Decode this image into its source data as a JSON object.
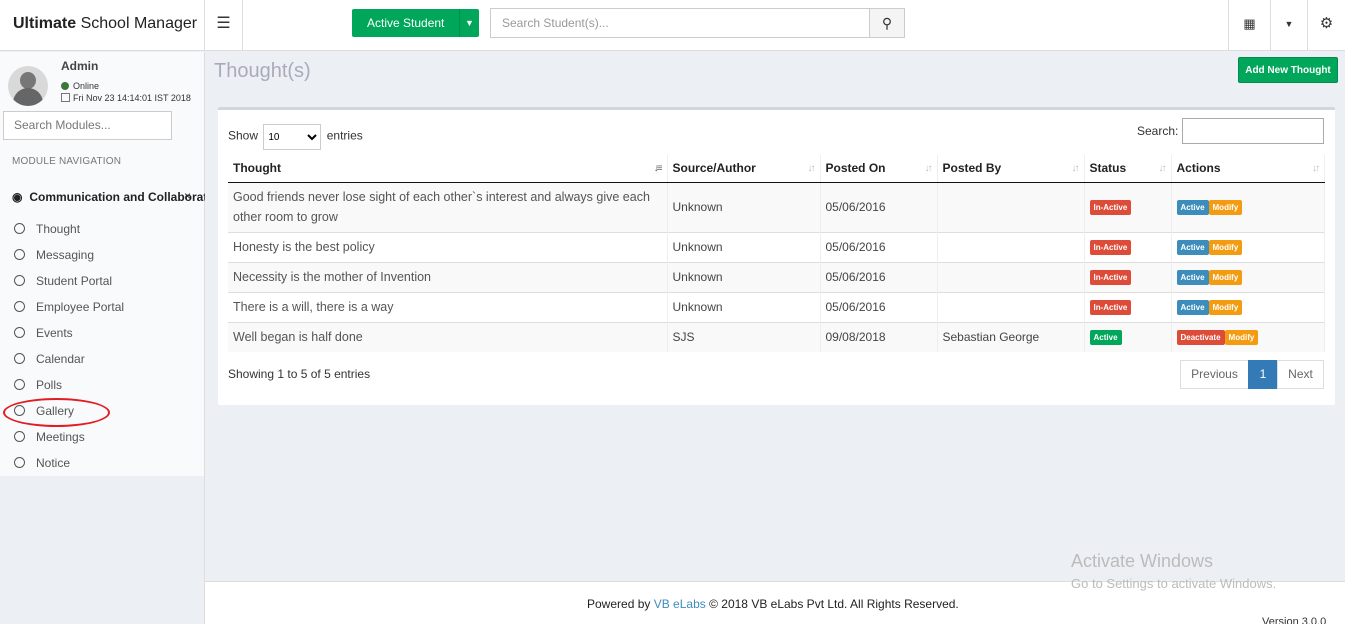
{
  "app": {
    "title_bold": "Ultimate",
    "title_rest": " School Manager"
  },
  "header": {
    "active_student": "Active Student",
    "search_placeholder": "Search Student(s)..."
  },
  "sidebar": {
    "user": "Admin",
    "status": "Online",
    "datetime": "Fri Nov 23 14:14:01 IST 2018",
    "search_placeholder": "Search Modules...",
    "section": "MODULE NAVIGATION",
    "group": "Communication and Collaborat",
    "items": [
      "Thought",
      "Messaging",
      "Student Portal",
      "Employee Portal",
      "Events",
      "Calendar",
      "Polls",
      "Gallery",
      "Meetings",
      "Notice"
    ]
  },
  "page": {
    "title": "Thought(s)",
    "add_button": "Add New Thought",
    "show_label": "Show",
    "entries_label": "entries",
    "entries_value": "10",
    "search_label": "Search:",
    "columns": [
      "Thought",
      "Source/Author",
      "Posted On",
      "Posted By",
      "Status",
      "Actions"
    ],
    "rows": [
      {
        "thought": "Good friends never lose sight of each other`s interest and always give each other room to grow",
        "author": "Unknown",
        "date": "05/06/2016",
        "by": "",
        "status": "In-Active",
        "a1": "Active",
        "a2": "Modify"
      },
      {
        "thought": "Honesty is the best policy",
        "author": "Unknown",
        "date": "05/06/2016",
        "by": "",
        "status": "In-Active",
        "a1": "Active",
        "a2": "Modify"
      },
      {
        "thought": "Necessity is the mother of Invention",
        "author": "Unknown",
        "date": "05/06/2016",
        "by": "",
        "status": "In-Active",
        "a1": "Active",
        "a2": "Modify"
      },
      {
        "thought": "There is a will, there is a way",
        "author": "Unknown",
        "date": "05/06/2016",
        "by": "",
        "status": "In-Active",
        "a1": "Active",
        "a2": "Modify"
      },
      {
        "thought": "Well began is half done",
        "author": "SJS",
        "date": "09/08/2018",
        "by": "Sebastian George",
        "status": "Active",
        "a1": "Deactivate",
        "a2": "Modify"
      }
    ],
    "info": "Showing 1 to 5 of 5 entries",
    "pagination": {
      "prev": "Previous",
      "page": "1",
      "next": "Next"
    }
  },
  "footer": {
    "powered": "Powered by",
    "link": "VB eLabs",
    "rights": "© 2018 VB eLabs Pvt Ltd. All Rights Reserved.",
    "version": "Version 3.0.0"
  },
  "watermark": {
    "line1": "Activate Windows",
    "line2": "Go to Settings to activate Windows."
  },
  "colors": {
    "green": "#00a65a",
    "red": "#dd4b39",
    "blue": "#3c8dbc",
    "orange": "#f39c12"
  }
}
